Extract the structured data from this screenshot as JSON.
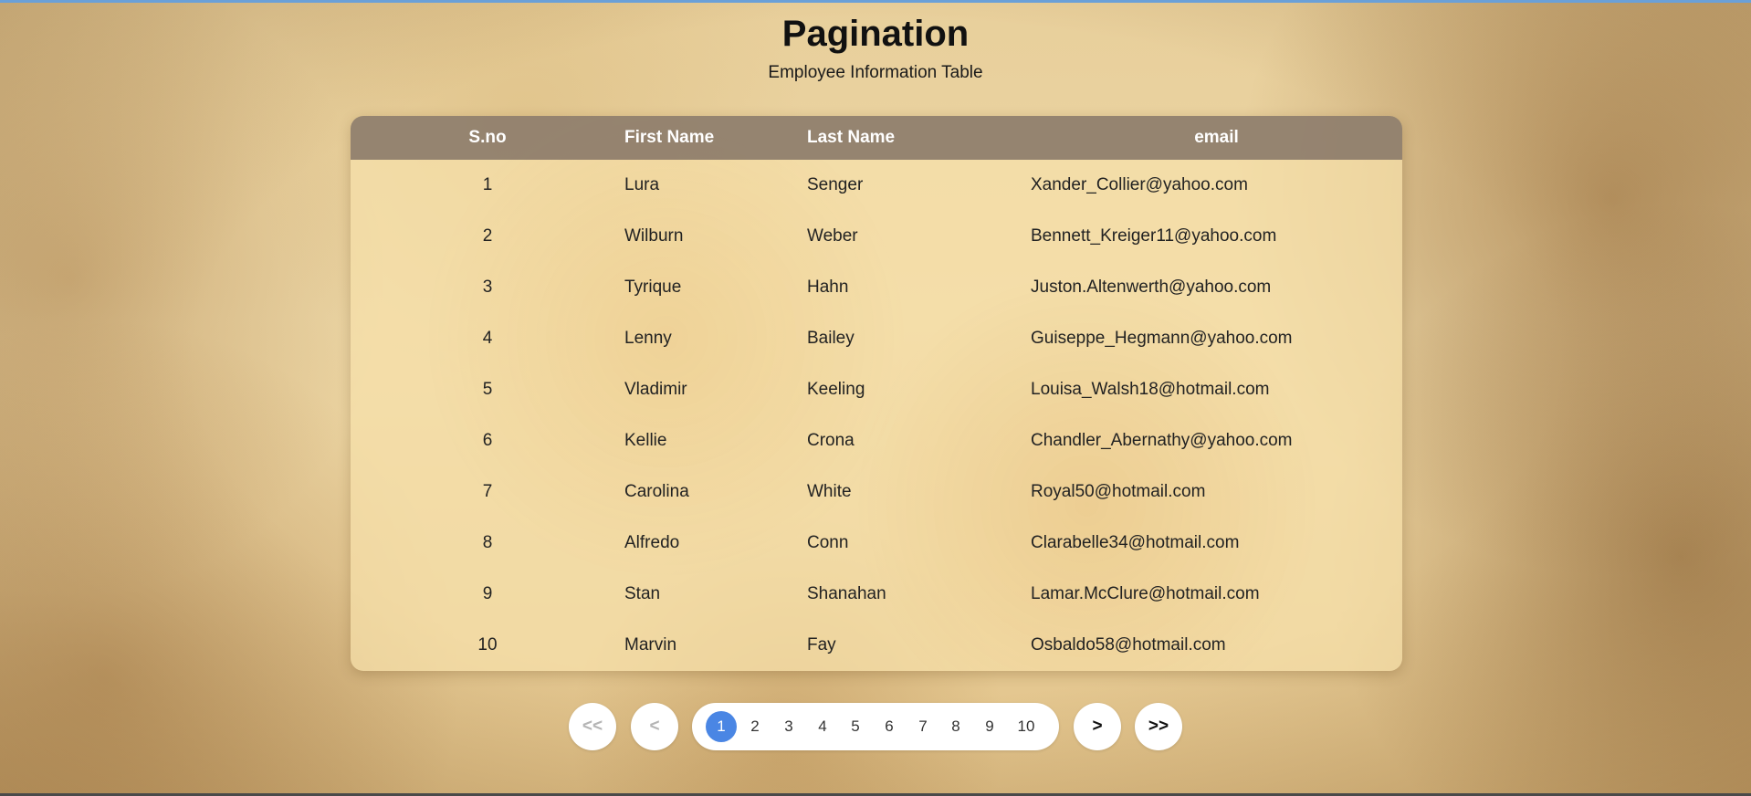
{
  "header": {
    "title": "Pagination",
    "subtitle": "Employee Information Table"
  },
  "table": {
    "columns": [
      "S.no",
      "First Name",
      "Last Name",
      "email"
    ],
    "rows": [
      {
        "sno": "1",
        "first": "Lura",
        "last": "Senger",
        "email": "Xander_Collier@yahoo.com"
      },
      {
        "sno": "2",
        "first": "Wilburn",
        "last": "Weber",
        "email": "Bennett_Kreiger11@yahoo.com"
      },
      {
        "sno": "3",
        "first": "Tyrique",
        "last": "Hahn",
        "email": "Juston.Altenwerth@yahoo.com"
      },
      {
        "sno": "4",
        "first": "Lenny",
        "last": "Bailey",
        "email": "Guiseppe_Hegmann@yahoo.com"
      },
      {
        "sno": "5",
        "first": "Vladimir",
        "last": "Keeling",
        "email": "Louisa_Walsh18@hotmail.com"
      },
      {
        "sno": "6",
        "first": "Kellie",
        "last": "Crona",
        "email": "Chandler_Abernathy@yahoo.com"
      },
      {
        "sno": "7",
        "first": "Carolina",
        "last": "White",
        "email": "Royal50@hotmail.com"
      },
      {
        "sno": "8",
        "first": "Alfredo",
        "last": "Conn",
        "email": "Clarabelle34@hotmail.com"
      },
      {
        "sno": "9",
        "first": "Stan",
        "last": "Shanahan",
        "email": "Lamar.McClure@hotmail.com"
      },
      {
        "sno": "10",
        "first": "Marvin",
        "last": "Fay",
        "email": "Osbaldo58@hotmail.com"
      }
    ]
  },
  "pagination": {
    "first_label": "<<",
    "prev_label": "<",
    "next_label": ">",
    "last_label": ">>",
    "pages": [
      "1",
      "2",
      "3",
      "4",
      "5",
      "6",
      "7",
      "8",
      "9",
      "10"
    ],
    "current_page": "1",
    "active_color": "#4a86e4"
  }
}
